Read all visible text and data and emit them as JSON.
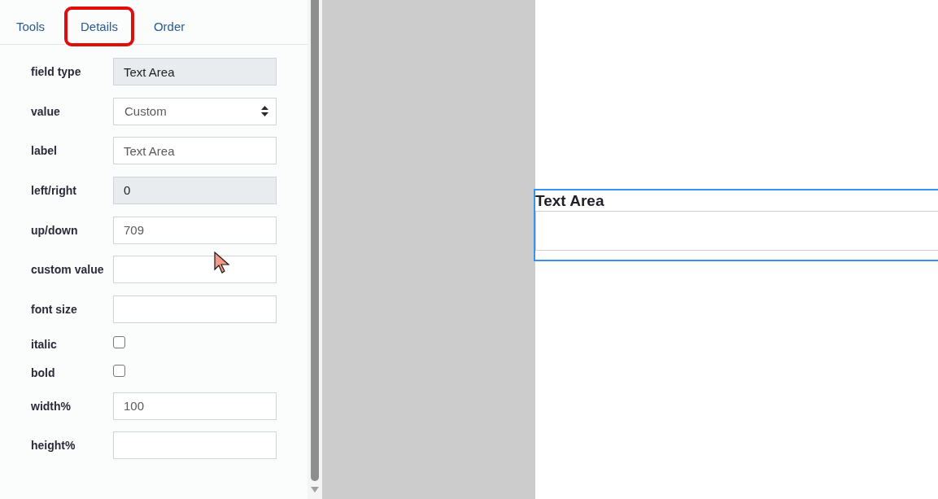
{
  "tabs": [
    {
      "label": "Tools",
      "selected": false
    },
    {
      "label": "Details",
      "selected": true
    },
    {
      "label": "Order",
      "selected": false
    }
  ],
  "fields": [
    {
      "kind": "text",
      "label": "field type",
      "value": "Text Area",
      "disabled": true
    },
    {
      "kind": "select",
      "label": "value",
      "value": "Custom",
      "disabled": false
    },
    {
      "kind": "text",
      "label": "label",
      "value": "Text Area",
      "disabled": false
    },
    {
      "kind": "text",
      "label": "left/right",
      "value": "0",
      "disabled": true
    },
    {
      "kind": "text",
      "label": "up/down",
      "value": "709",
      "disabled": false
    },
    {
      "kind": "text",
      "label": "custom value",
      "disabled": false
    },
    {
      "kind": "text",
      "label": "font size",
      "disabled": false
    },
    {
      "kind": "checkbox",
      "label": "italic",
      "checked": false
    },
    {
      "kind": "checkbox",
      "label": "bold",
      "checked": false
    },
    {
      "kind": "text",
      "label": "width%",
      "value": "100",
      "disabled": false
    },
    {
      "kind": "text",
      "label": "height%",
      "disabled": false
    }
  ],
  "canvas": {
    "element": {
      "label": "Text Area",
      "selected": true
    }
  }
}
